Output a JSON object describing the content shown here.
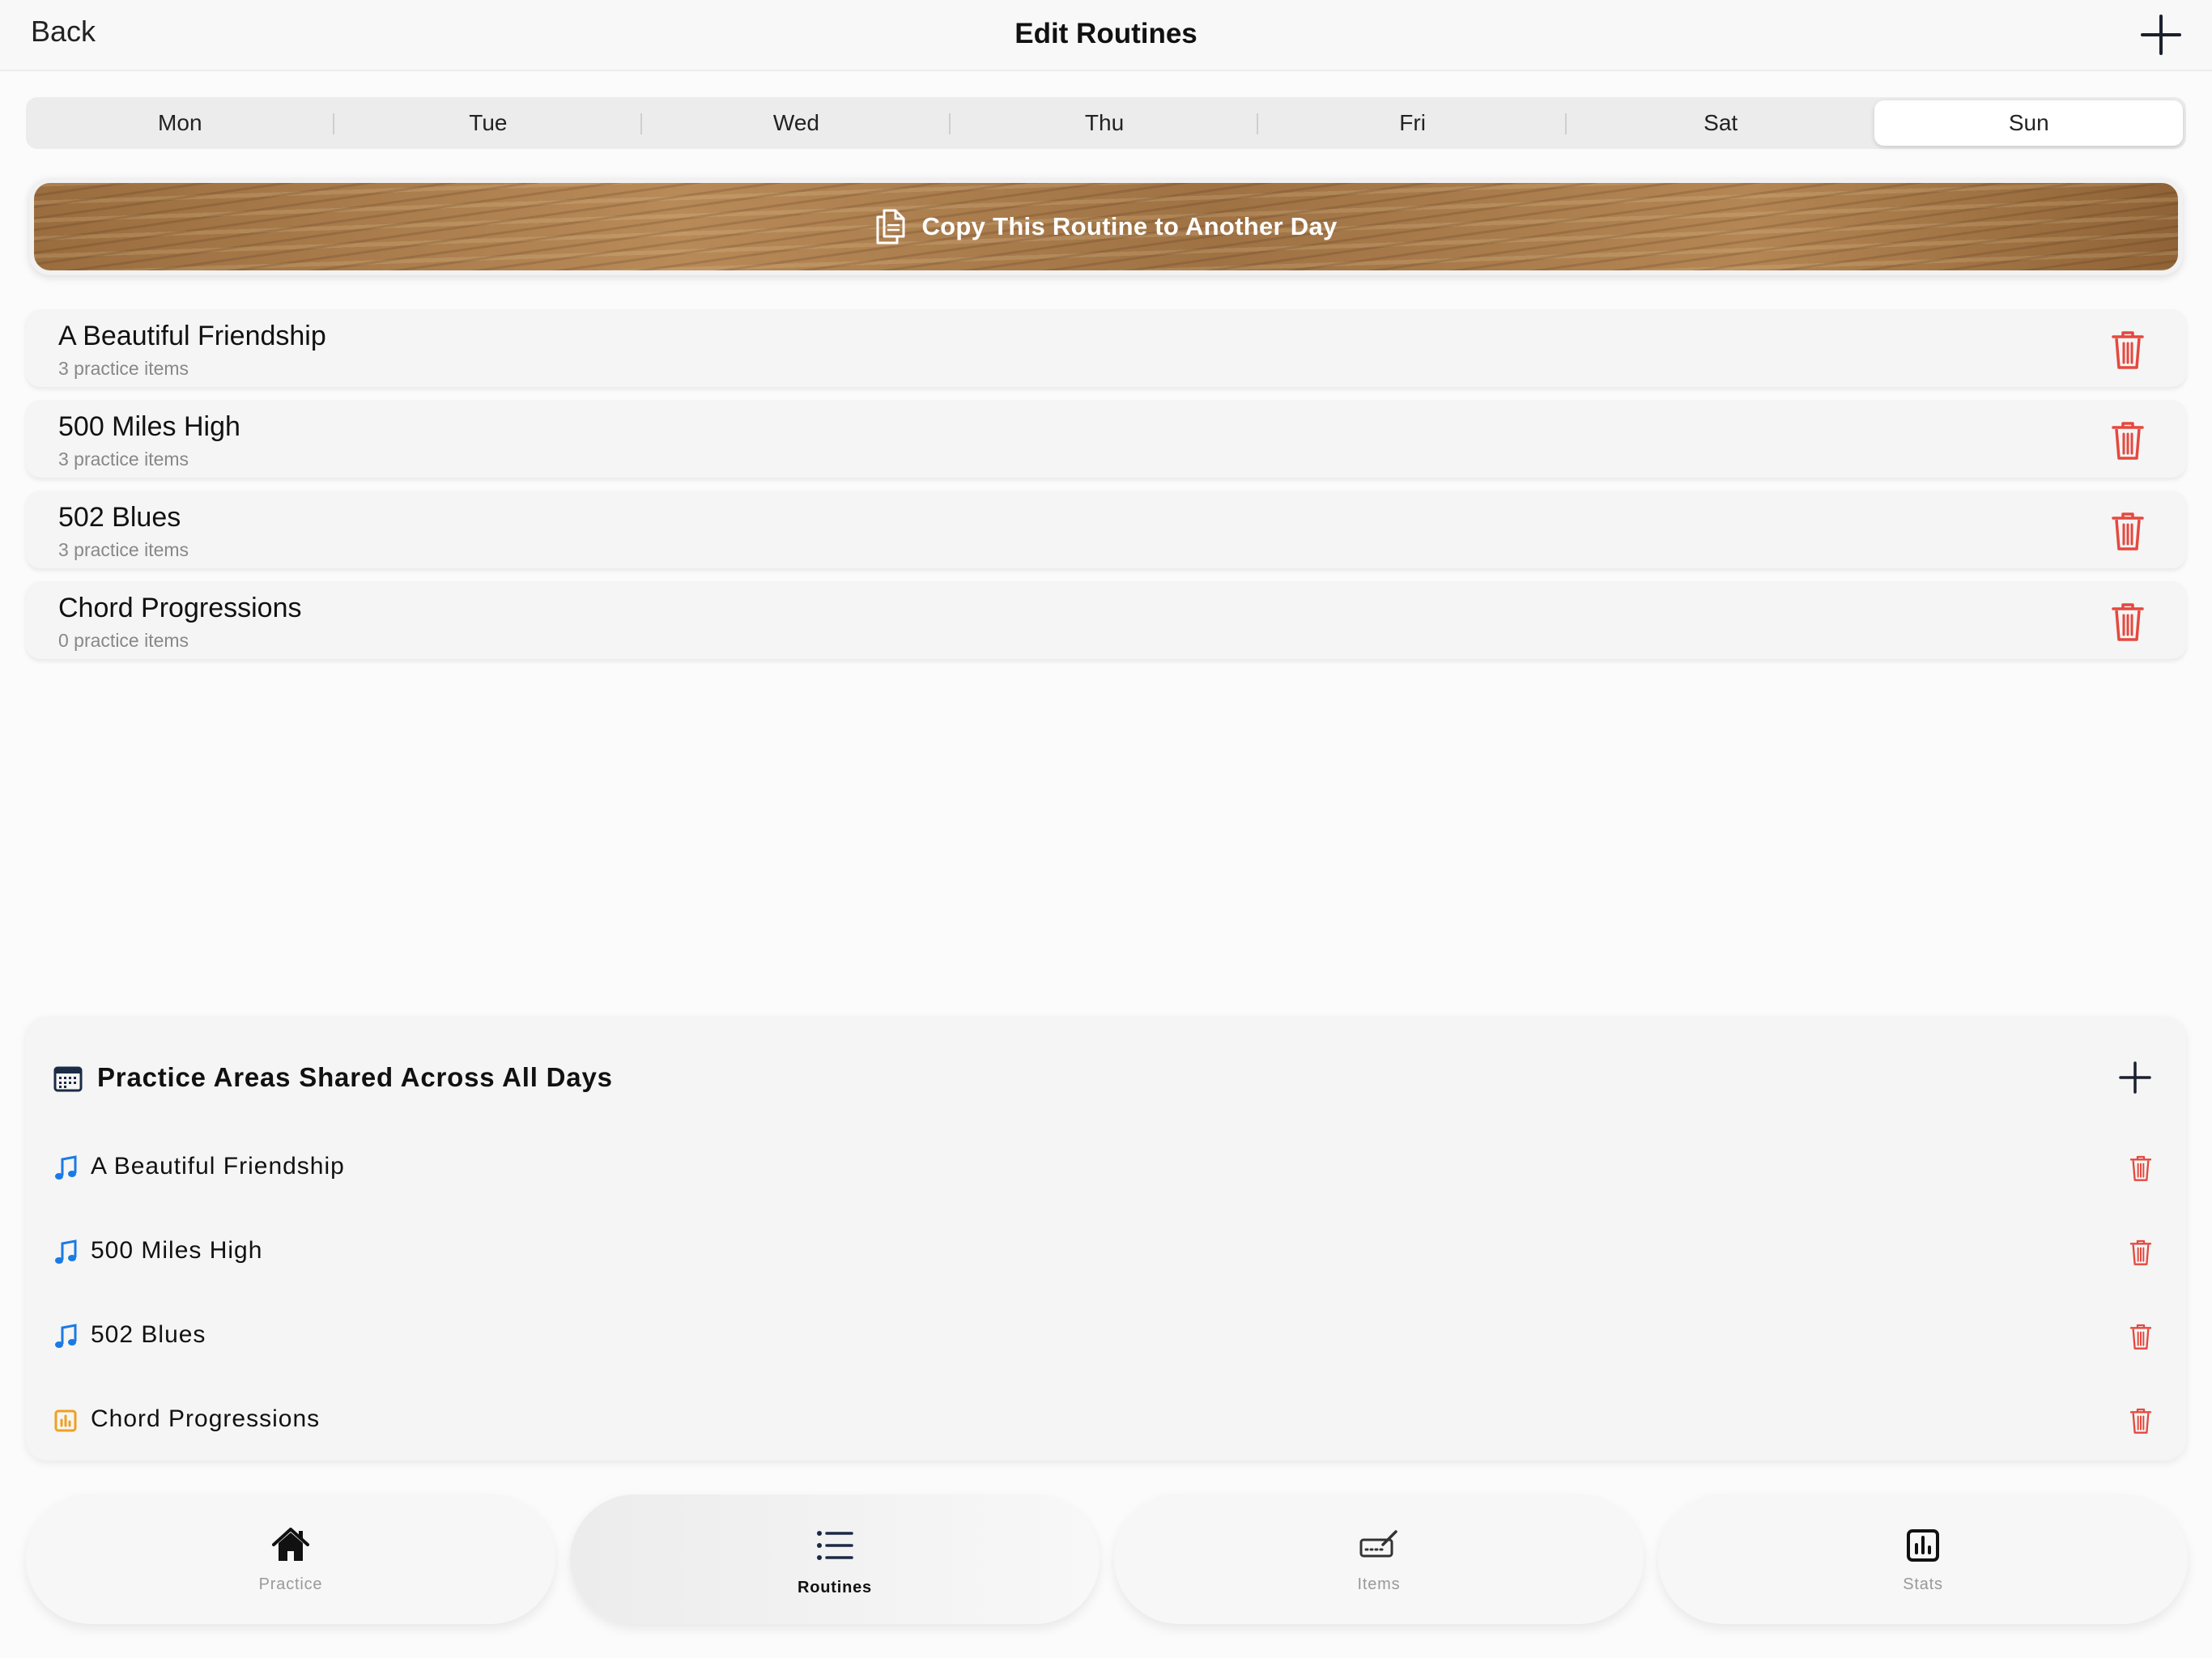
{
  "header": {
    "back_label": "Back",
    "title": "Edit Routines",
    "add_icon": "plus-icon"
  },
  "days": {
    "items": [
      "Mon",
      "Tue",
      "Wed",
      "Thu",
      "Fri",
      "Sat",
      "Sun"
    ],
    "selected": "Sun"
  },
  "copy_button": {
    "label": "Copy This Routine to Another Day",
    "icon": "copy-document-icon"
  },
  "routines": [
    {
      "name": "A Beautiful Friendship",
      "subtitle": "3 practice items"
    },
    {
      "name": "500 Miles High",
      "subtitle": "3 practice items"
    },
    {
      "name": "502 Blues",
      "subtitle": "3 practice items"
    },
    {
      "name": "Chord Progressions",
      "subtitle": "0 practice items"
    }
  ],
  "shared": {
    "title": "Practice Areas Shared Across All Days",
    "icon": "calendar-icon",
    "items": [
      {
        "name": "A Beautiful Friendship",
        "icon": "music-note-icon"
      },
      {
        "name": "500 Miles High",
        "icon": "music-note-icon"
      },
      {
        "name": "502 Blues",
        "icon": "music-note-icon"
      },
      {
        "name": "Chord Progressions",
        "icon": "chart-square-icon"
      }
    ]
  },
  "tabs": [
    {
      "label": "Practice",
      "icon": "house-icon"
    },
    {
      "label": "Routines",
      "icon": "list-icon",
      "active": true
    },
    {
      "label": "Items",
      "icon": "keyboard-pencil-icon"
    },
    {
      "label": "Stats",
      "icon": "bar-chart-icon"
    }
  ],
  "colors": {
    "accent_blue": "#1a7ae6",
    "trash_red": "#e5483f",
    "wood_brown": "#a77a4b",
    "chart_orange": "#f0a020"
  }
}
